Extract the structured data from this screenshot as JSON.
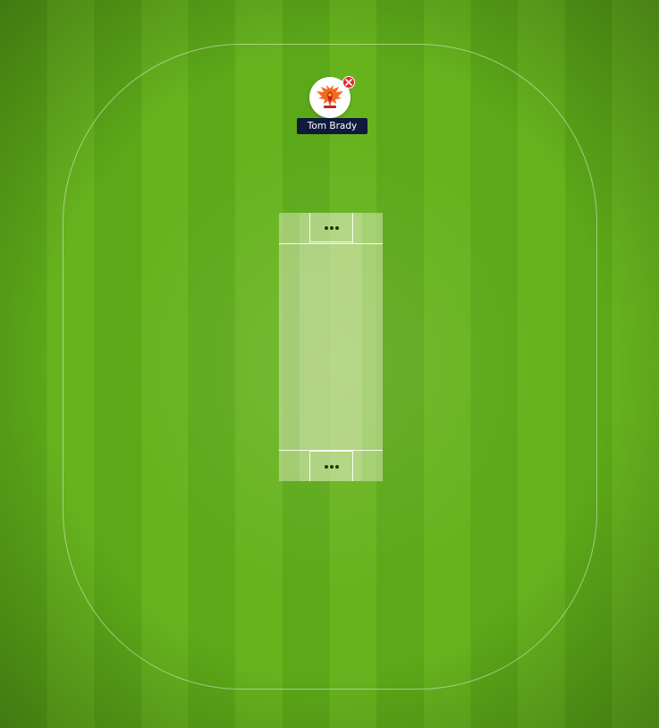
{
  "colors": {
    "grass_dark": "#5ba818",
    "grass_light": "#66b31e",
    "pitch": "#cfe0a8",
    "name_tag_bg": "#0f1a3c",
    "remove_badge": "#e8262d"
  },
  "player": {
    "name": "Tom Brady",
    "avatar_icon": "team-logo-icon",
    "remove_icon": "close-icon"
  }
}
